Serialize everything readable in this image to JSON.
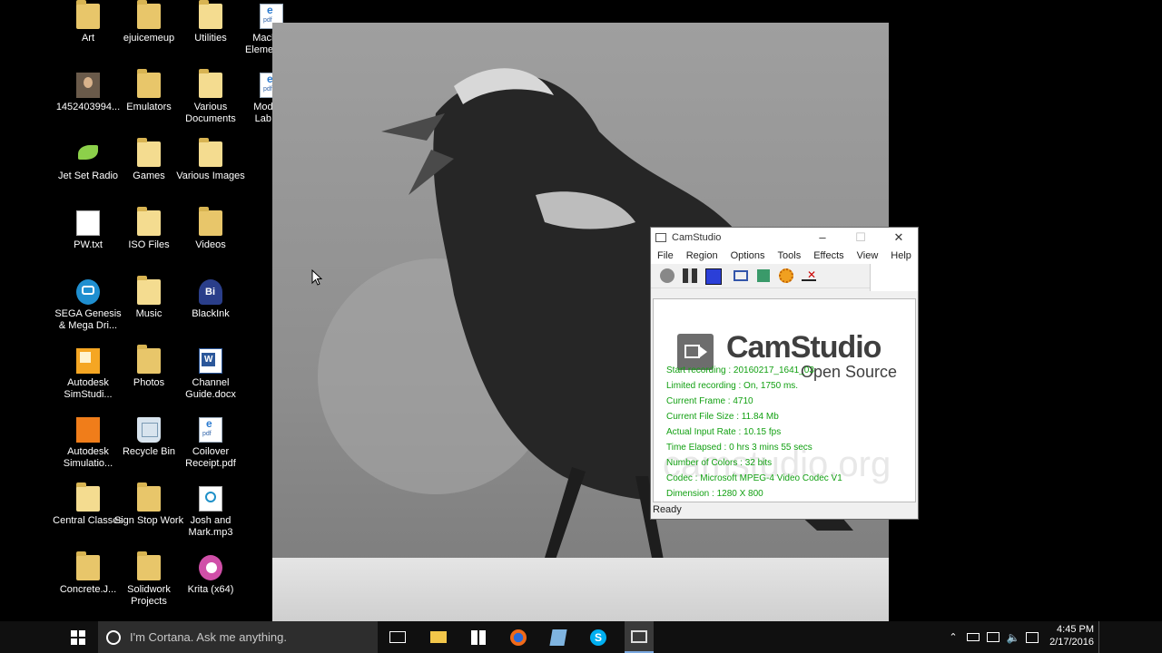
{
  "desktop": {
    "icons": [
      {
        "label": "Art",
        "icon": "art-folder-icon"
      },
      {
        "label": "ejuicemeup",
        "icon": "folder-icon"
      },
      {
        "label": "Utilities",
        "icon": "folder-icon"
      },
      {
        "label": "Machine Elements ...",
        "icon": "pdf-icon"
      },
      {
        "label": "1452403994...",
        "icon": "photo-icon"
      },
      {
        "label": "Emulators",
        "icon": "folder-icon"
      },
      {
        "label": "Various Documents",
        "icon": "folder-icon"
      },
      {
        "label": "Model T Lab.pdf",
        "icon": "pdf-icon"
      },
      {
        "label": "Jet Set Radio",
        "icon": "jet-set-radio-icon"
      },
      {
        "label": "Games",
        "icon": "folder-icon"
      },
      {
        "label": "Various Images",
        "icon": "folder-icon"
      },
      {
        "label": "PW.txt",
        "icon": "text-file-icon"
      },
      {
        "label": "ISO Files",
        "icon": "folder-icon"
      },
      {
        "label": "Videos",
        "icon": "folder-icon"
      },
      {
        "label": "SEGA Genesis & Mega Dri...",
        "icon": "sega-icon"
      },
      {
        "label": "Music",
        "icon": "folder-icon"
      },
      {
        "label": "BlackInk",
        "icon": "blackink-icon"
      },
      {
        "label": "Autodesk SimStudi...",
        "icon": "autodesk-icon"
      },
      {
        "label": "Photos",
        "icon": "folder-icon"
      },
      {
        "label": "Channel Guide.docx",
        "icon": "word-icon"
      },
      {
        "label": "Autodesk Simulatio...",
        "icon": "autodesk-icon"
      },
      {
        "label": "Recycle Bin",
        "icon": "recycle-bin-icon"
      },
      {
        "label": "Coilover Receipt.pdf",
        "icon": "pdf-icon"
      },
      {
        "label": "Central Classes",
        "icon": "folder-icon"
      },
      {
        "label": "Sign Stop Work",
        "icon": "folder-icon"
      },
      {
        "label": "Josh and Mark.mp3",
        "icon": "music-file-icon"
      },
      {
        "label": "Concrete.J...",
        "icon": "folder-icon"
      },
      {
        "label": "Solidwork Projects",
        "icon": "folder-icon"
      },
      {
        "label": "Krita (x64)",
        "icon": "krita-icon"
      }
    ]
  },
  "camstudio": {
    "title": "CamStudio",
    "menu": [
      "File",
      "Region",
      "Options",
      "Tools",
      "Effects",
      "View",
      "Help"
    ],
    "logo_title": "CamStudio",
    "logo_sub": "Open Source",
    "watermark": "camstudio.org",
    "stats": [
      "Start recording : 20160217_1641_03",
      "Limited recording : On, 1750 ms.",
      "Current Frame : 4710",
      "Current File Size : 11.84 Mb",
      "Actual Input Rate : 10.15 fps",
      "Time Elapsed : 0 hrs 3 mins 55 secs",
      "Number of Colors : 32 bits",
      "Codec : Microsoft MPEG-4 Video Codec V1",
      "Dimension : 1280 X 800"
    ],
    "status": "Ready"
  },
  "taskbar": {
    "cortana_placeholder": "I'm Cortana. Ask me anything.",
    "time": "4:45 PM",
    "date": "2/17/2016"
  },
  "colors": {
    "taskbar": "#101010",
    "stats_text": "#12a012",
    "accent_blue": "#2b3fd8"
  }
}
